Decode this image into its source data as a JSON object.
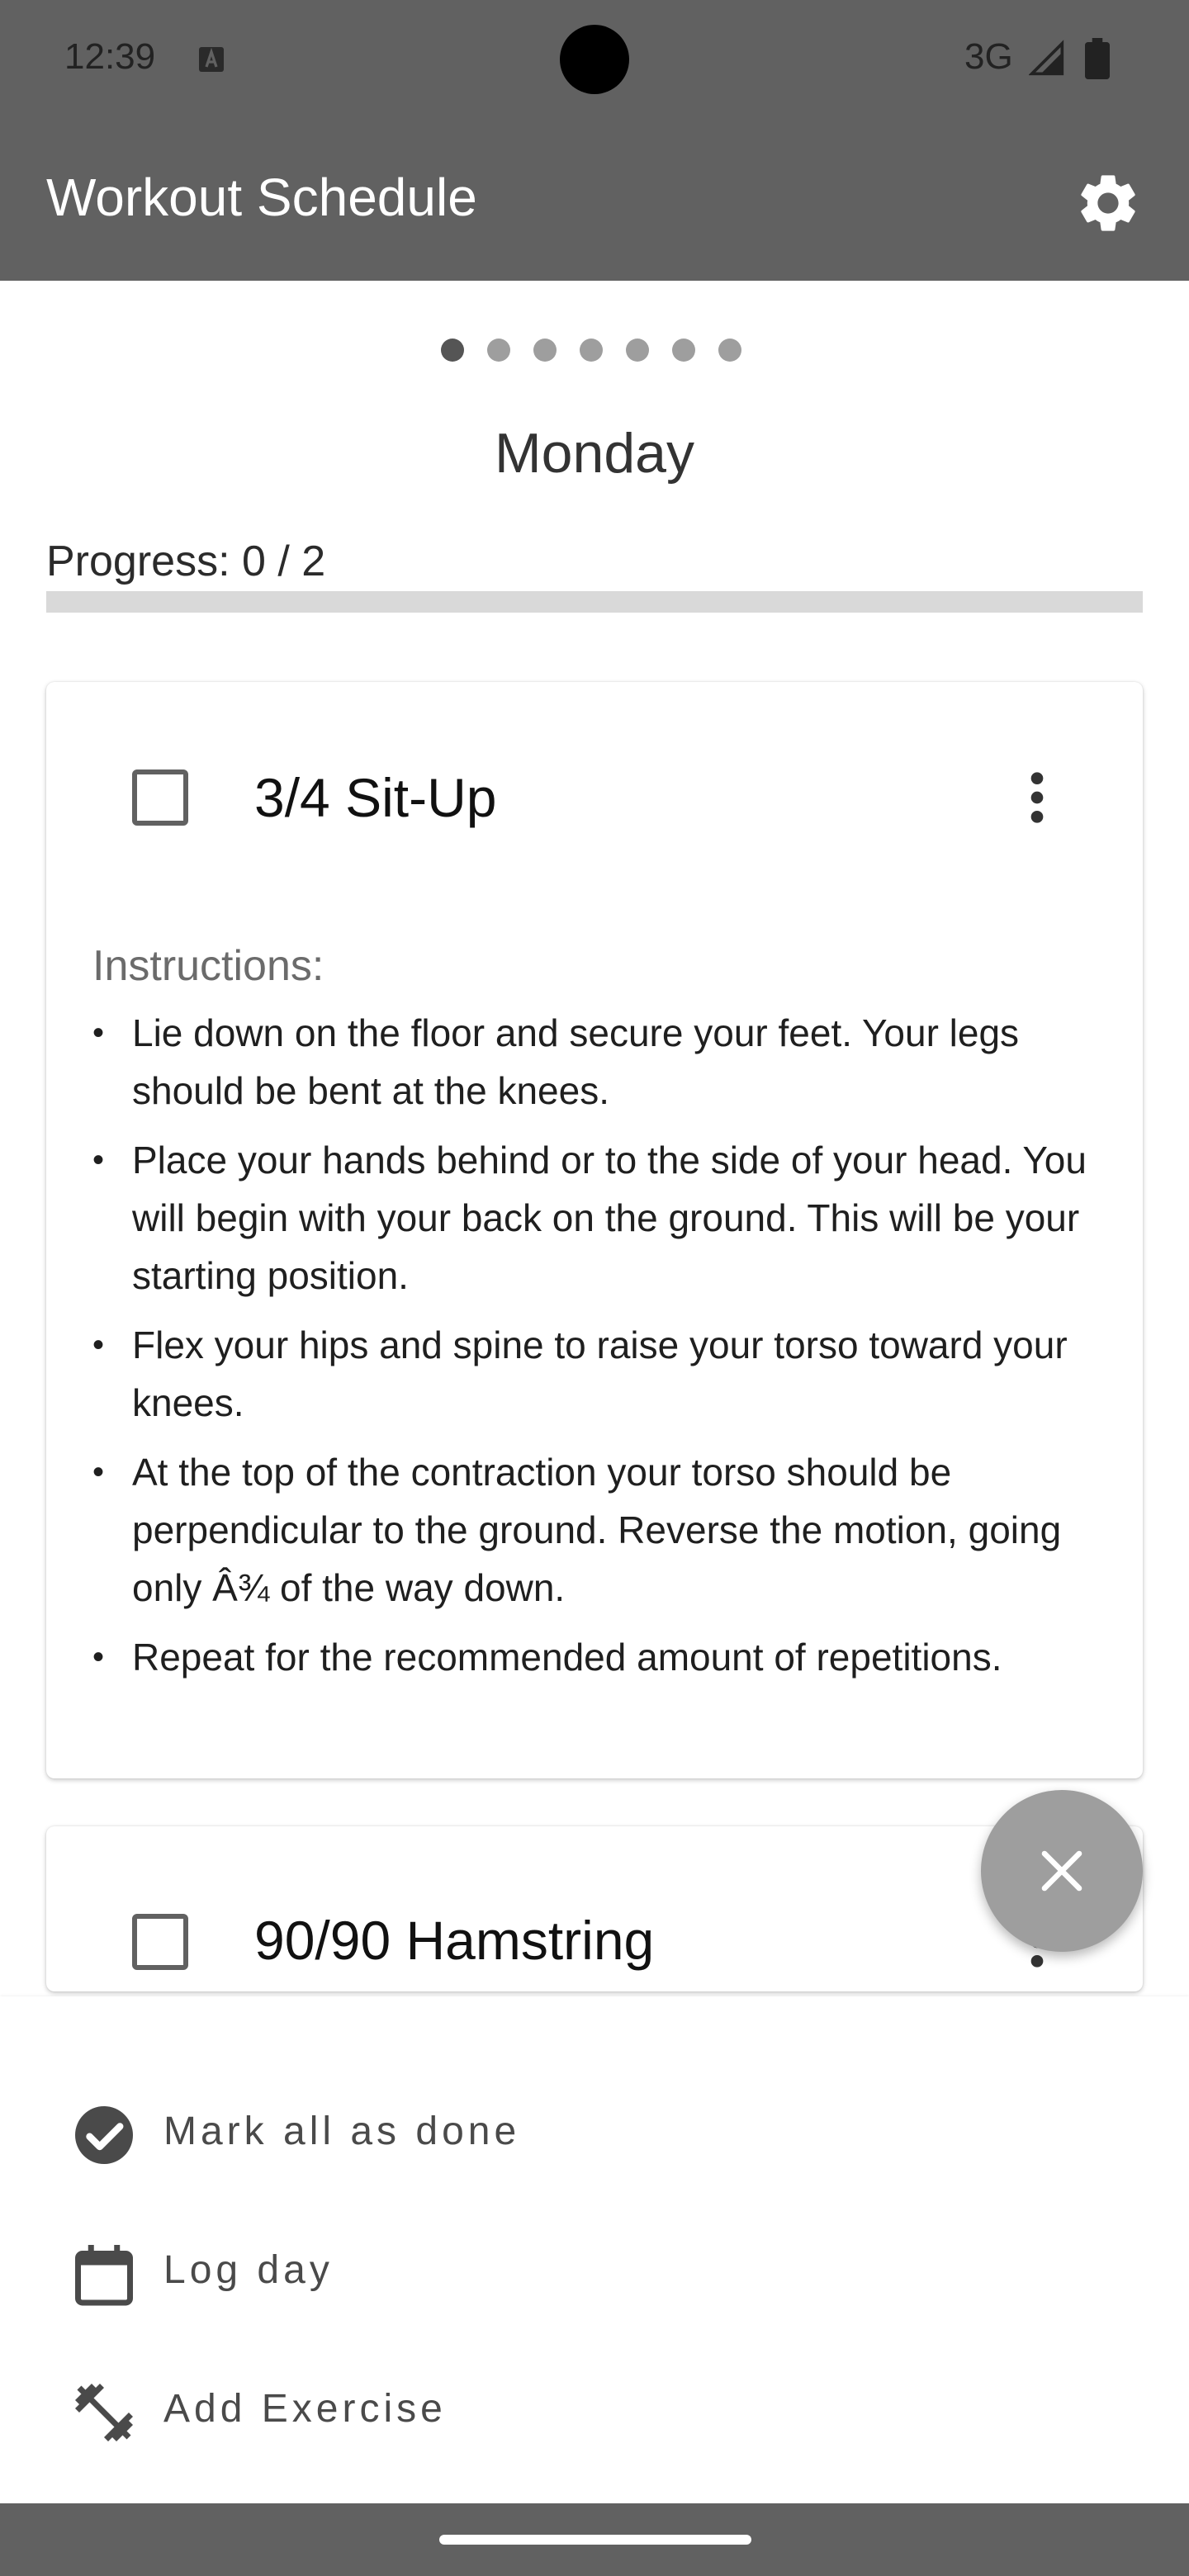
{
  "status_bar": {
    "time": "12:39",
    "network": "3G",
    "icons": [
      "a-icon",
      "signal-icon",
      "battery-icon"
    ]
  },
  "app_bar": {
    "title": "Workout Schedule",
    "settings_icon": "gear-icon"
  },
  "pager": {
    "dot_count": 7,
    "active_index": 0
  },
  "day": {
    "title": "Monday"
  },
  "progress": {
    "label": "Progress: 0 / 2",
    "done": 0,
    "total": 2
  },
  "exercises": [
    {
      "name": "3/4 Sit-Up",
      "checked": false,
      "instructions_label": "Instructions:",
      "instructions": [
        "Lie down on the floor and secure your feet. Your legs should be bent at the knees.",
        "Place your hands behind or to the side of your head. You will begin with your back on the ground. This will be your starting position.",
        "Flex your hips and spine to raise your torso toward your knees.",
        "At the top of the contraction your torso should be perpendicular to the ground. Reverse the motion, going only Â¾ of the way down.",
        "Repeat for the recommended amount of repetitions."
      ]
    },
    {
      "name": "90/90 Hamstring",
      "checked": false
    }
  ],
  "bullet": "•",
  "fab": {
    "icon": "close-icon"
  },
  "bottom_menu": {
    "items": [
      {
        "label": "Mark all as done",
        "icon": "check-circle-icon"
      },
      {
        "label": "Log day",
        "icon": "calendar-icon"
      },
      {
        "label": "Add Exercise",
        "icon": "dumbbell-icon"
      }
    ]
  },
  "colors": {
    "app_bar": "#616161",
    "accent": "#616161",
    "fab": "#9e9e9e"
  }
}
